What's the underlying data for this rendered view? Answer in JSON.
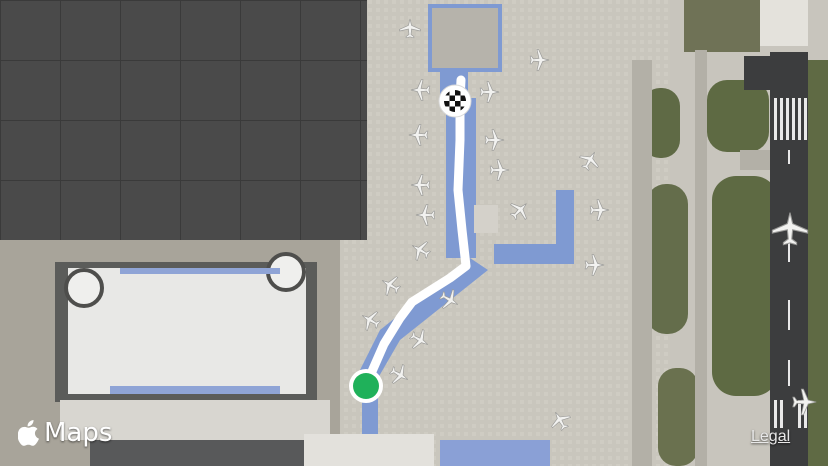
{
  "brand": {
    "icon": "apple-logo-icon",
    "label": "Maps"
  },
  "legal_label": "Legal",
  "route": {
    "start_icon": "start-point-icon",
    "end_icon": "destination-checkered-flag-icon",
    "colors": {
      "route": "#ffffff",
      "start": "#1fb15a",
      "end_ring": "#ffffff"
    }
  },
  "map": {
    "style": "satellite",
    "loading_tile_color": "#4a4a4a"
  }
}
